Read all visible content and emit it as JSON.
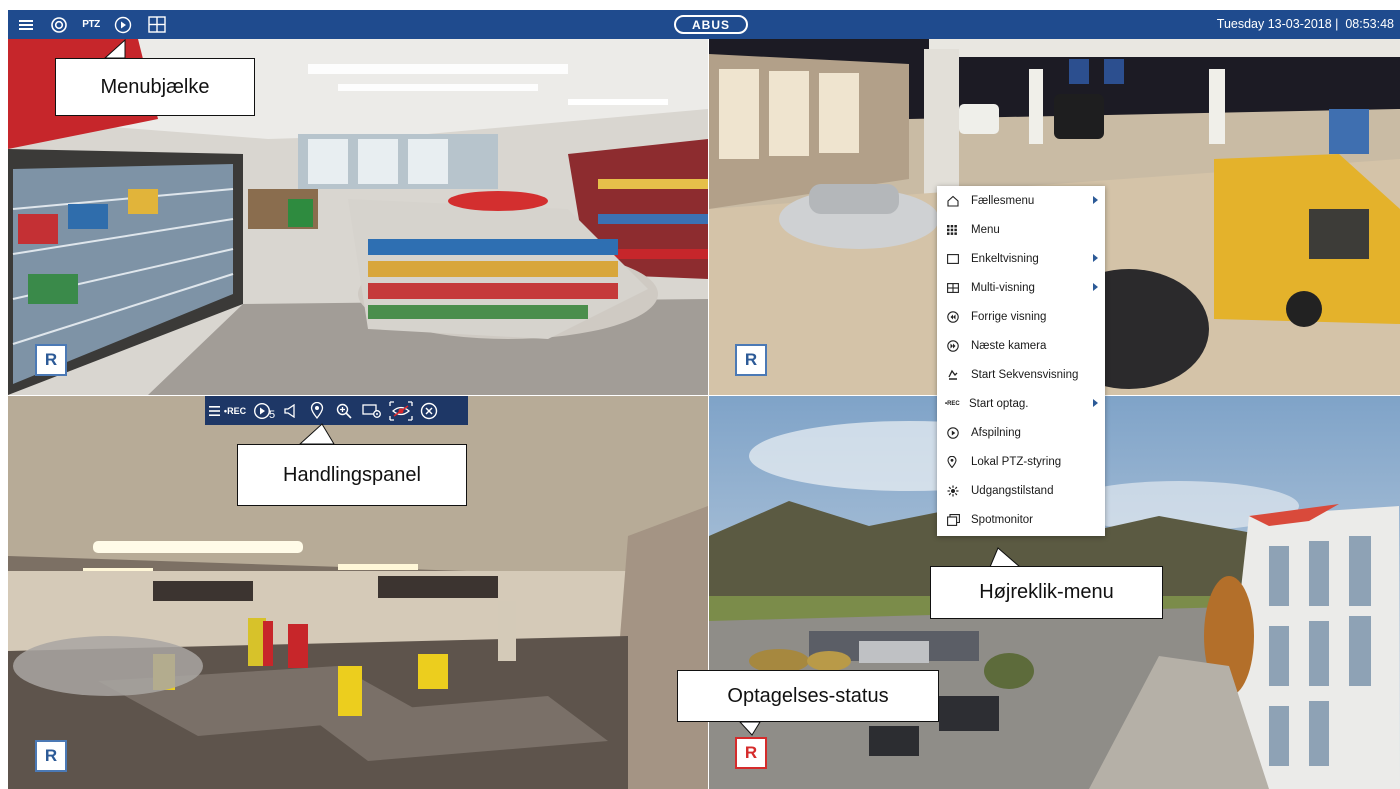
{
  "topbar": {
    "menu_icon": "hamburger-icon",
    "camera_icon": "camera-icon",
    "ptz_label": "PTZ",
    "playback_icon": "playback-icon",
    "layout_icon": "grid-layout-icon",
    "logo_text": "ABUS",
    "datetime": "Tuesday 13-03-2018 |  08:53:48",
    "color": "#1f4b8e"
  },
  "cameras": [
    {
      "name": "store-interior",
      "badge": "R"
    },
    {
      "name": "gas-station-forecourt",
      "badge": "R"
    },
    {
      "name": "parking-garage",
      "badge": "R"
    },
    {
      "name": "office-building-exterior",
      "badge": "R",
      "badge_color": "#d52b2b"
    }
  ],
  "action_panel": {
    "rec_label": "•REC",
    "sequence_sub": "5",
    "icons": [
      "menu-icon",
      "record-icon",
      "sequence-icon",
      "audio-icon",
      "ptz-icon",
      "zoom-icon",
      "image-settings-icon",
      "privacy-icon",
      "close-icon"
    ]
  },
  "context_menu": {
    "items": [
      {
        "label": "Fællesmenu",
        "icon": "home-icon",
        "submenu": true
      },
      {
        "label": "Menu",
        "icon": "grid-icon",
        "submenu": false
      },
      {
        "label": "Enkeltvisning",
        "icon": "single-view-icon",
        "submenu": true
      },
      {
        "label": "Multi-visning",
        "icon": "multi-view-icon",
        "submenu": true
      },
      {
        "label": "Forrige visning",
        "icon": "previous-icon",
        "submenu": false
      },
      {
        "label": "Næste kamera",
        "icon": "next-icon",
        "submenu": false
      },
      {
        "label": "Start Sekvensvisning",
        "icon": "sequence-icon",
        "submenu": false
      },
      {
        "label": "Start optag.",
        "icon": "rec-icon",
        "rec_text": "•REC",
        "submenu": true
      },
      {
        "label": "Afspilning",
        "icon": "playback-icon",
        "submenu": false
      },
      {
        "label": "Lokal PTZ-styring",
        "icon": "ptz-icon",
        "submenu": false
      },
      {
        "label": "Udgangstilstand",
        "icon": "output-icon",
        "submenu": false
      },
      {
        "label": "Spotmonitor",
        "icon": "spot-monitor-icon",
        "submenu": false
      }
    ]
  },
  "callouts": {
    "menubar": "Menubjælke",
    "action_panel": "Handlingspanel",
    "context_menu": "Højreklik-menu",
    "rec_status": "Optagelses-status"
  }
}
